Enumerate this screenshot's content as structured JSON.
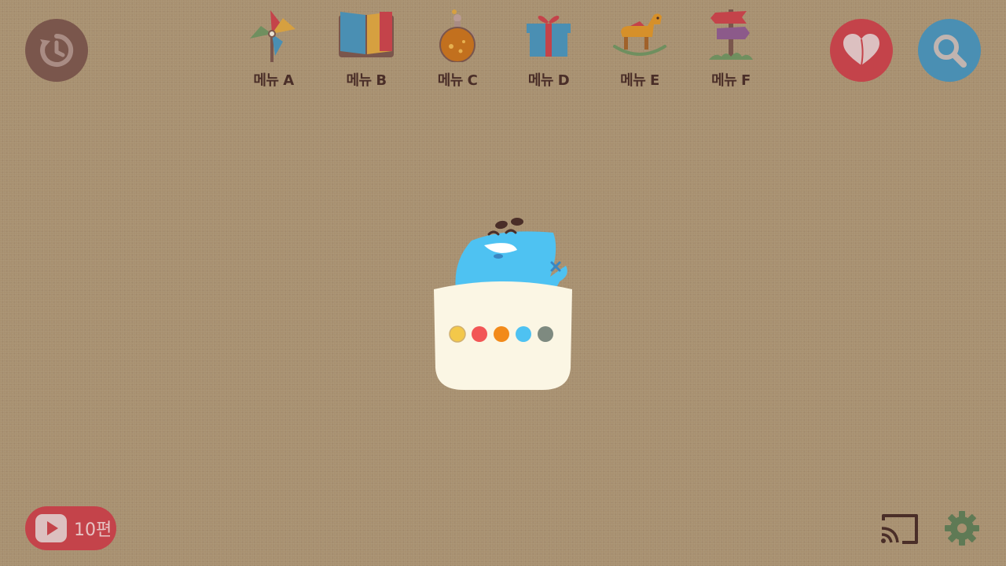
{
  "colors": {
    "background": "#a89070",
    "history_button": "#7a564c",
    "favorites_button": "#c4434a",
    "search_button": "#4a8fb3",
    "label_text": "#4a2e28",
    "video_pill": "#c4434a",
    "settings_icon": "#5f7a55"
  },
  "menu": [
    {
      "label": "메뉴 A",
      "icon": "pinwheel-icon"
    },
    {
      "label": "메뉴 B",
      "icon": "book-icon"
    },
    {
      "label": "메뉴 C",
      "icon": "potion-icon"
    },
    {
      "label": "메뉴 D",
      "icon": "gift-icon"
    },
    {
      "label": "메뉴 E",
      "icon": "rocking-horse-icon"
    },
    {
      "label": "메뉴 F",
      "icon": "signpost-icon"
    }
  ],
  "top_buttons": {
    "history": {
      "icon": "history-icon"
    },
    "favorites": {
      "icon": "heart-icon"
    },
    "search": {
      "icon": "search-icon"
    }
  },
  "mascot": {
    "dots": [
      "#f3c84a",
      "#f25656",
      "#f28a1a",
      "#4ec2f2",
      "#7e8a80"
    ]
  },
  "bottom": {
    "video_count": "10편",
    "video_icon": "play-icon",
    "cast_icon": "cast-icon",
    "settings_icon": "gear-icon"
  }
}
